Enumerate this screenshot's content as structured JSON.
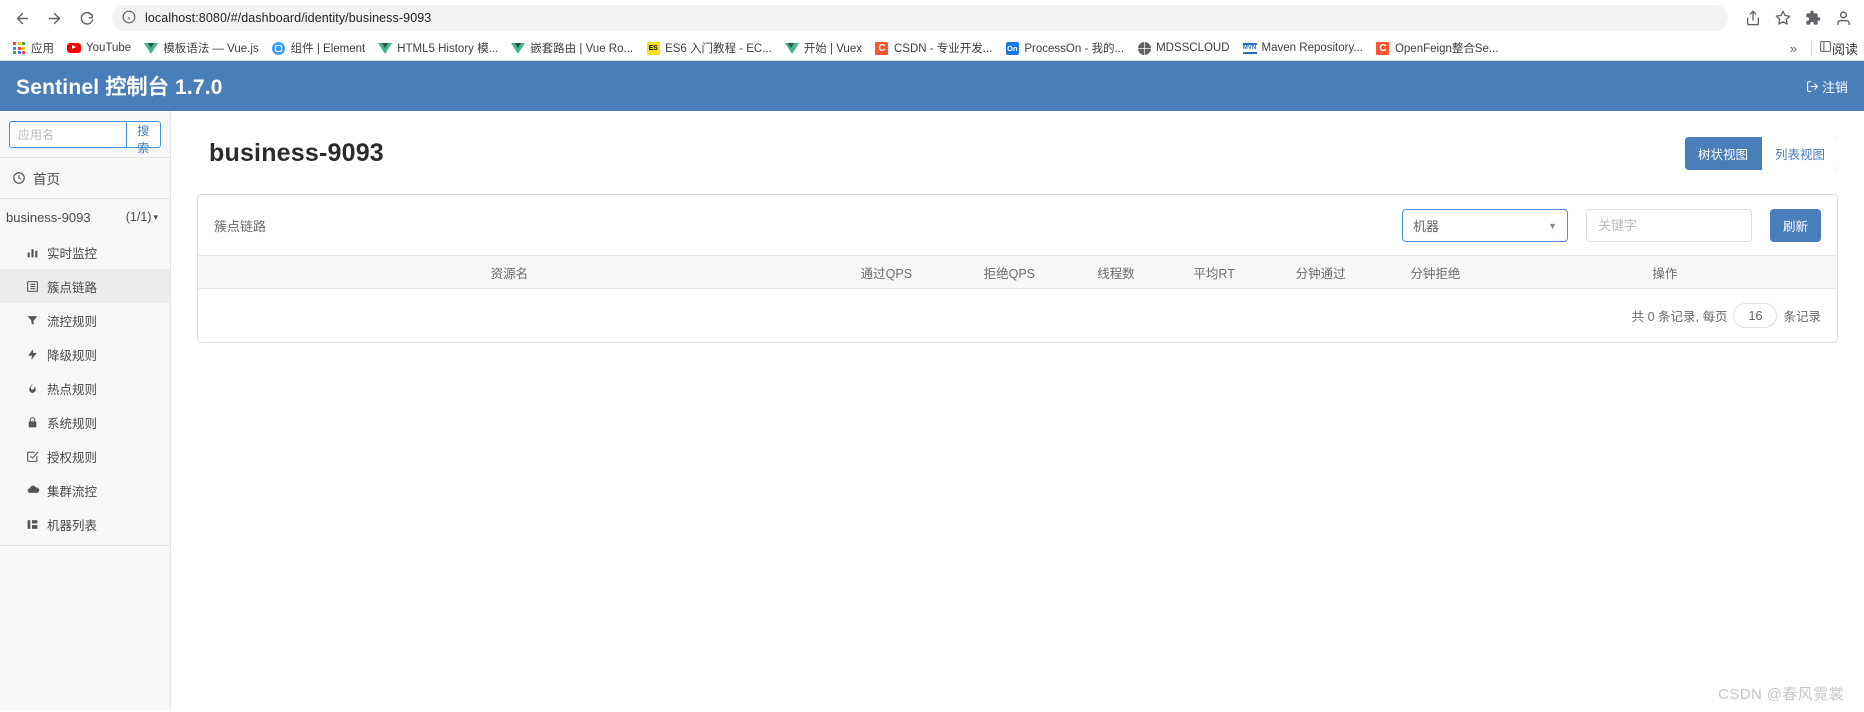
{
  "browser": {
    "url": "localhost:8080/#/dashboard/identity/business-9093",
    "nav": {
      "back": "back-arrow",
      "forward": "forward-arrow",
      "reload": "reload"
    },
    "overflow_label": "»",
    "reading_list_label": "阅读",
    "bookmarks": [
      {
        "label": "应用",
        "icon": "apps-grid-icon"
      },
      {
        "label": "YouTube",
        "icon": "youtube-icon"
      },
      {
        "label": "模板语法 — Vue.js",
        "icon": "vue-icon"
      },
      {
        "label": "组件 | Element",
        "icon": "element-icon"
      },
      {
        "label": "HTML5 History 模...",
        "icon": "vue-icon"
      },
      {
        "label": "嵌套路由 | Vue Ro...",
        "icon": "vue-icon"
      },
      {
        "label": "ES6 入门教程 - EC...",
        "icon": "es6-icon"
      },
      {
        "label": "开始 | Vuex",
        "icon": "vue-icon"
      },
      {
        "label": "CSDN - 专业开发...",
        "icon": "csdn-icon"
      },
      {
        "label": "ProcessOn - 我的...",
        "icon": "processon-icon"
      },
      {
        "label": "MDSSCLOUD",
        "icon": "globe-icon"
      },
      {
        "label": "Maven Repository...",
        "icon": "maven-icon"
      },
      {
        "label": "OpenFeign整合Se...",
        "icon": "csdn-icon"
      }
    ]
  },
  "header": {
    "title": "Sentinel 控制台 1.7.0",
    "logout_label": "注销",
    "bg_color": "#4a7ebb"
  },
  "sidebar": {
    "search": {
      "placeholder": "应用名",
      "button_label": "搜索"
    },
    "home_label": "首页",
    "app_node": {
      "name": "business-9093",
      "count": "(1/1)"
    },
    "items": [
      {
        "label": "实时监控",
        "icon": "chart-bar-icon",
        "active": false
      },
      {
        "label": "簇点链路",
        "icon": "list-icon",
        "active": true
      },
      {
        "label": "流控规则",
        "icon": "filter-icon",
        "active": false
      },
      {
        "label": "降级规则",
        "icon": "bolt-icon",
        "active": false
      },
      {
        "label": "热点规则",
        "icon": "fire-icon",
        "active": false
      },
      {
        "label": "系统规则",
        "icon": "lock-icon",
        "active": false
      },
      {
        "label": "授权规则",
        "icon": "check-square-icon",
        "active": false
      },
      {
        "label": "集群流控",
        "icon": "cloud-icon",
        "active": false
      },
      {
        "label": "机器列表",
        "icon": "grid-icon",
        "active": false
      }
    ]
  },
  "main": {
    "page_title": "business-9093",
    "view_toggle": [
      {
        "label": "树状视图",
        "active": true
      },
      {
        "label": "列表视图",
        "active": false
      }
    ],
    "card": {
      "title": "簇点链路",
      "machine_select": {
        "value": "机器",
        "caret": "chevron-down-icon"
      },
      "keyword_input": {
        "value": "",
        "placeholder": "关键字"
      },
      "refresh_label": "刷新",
      "columns": [
        "资源名",
        "通过QPS",
        "拒绝QPS",
        "线程数",
        "平均RT",
        "分钟通过",
        "分钟拒绝",
        "操作"
      ],
      "rows": [],
      "pager": {
        "prefix": "共 0 条记录, 每页",
        "page_size": "16",
        "suffix": "条记录"
      }
    }
  },
  "watermark": "CSDN @春风霓裳"
}
